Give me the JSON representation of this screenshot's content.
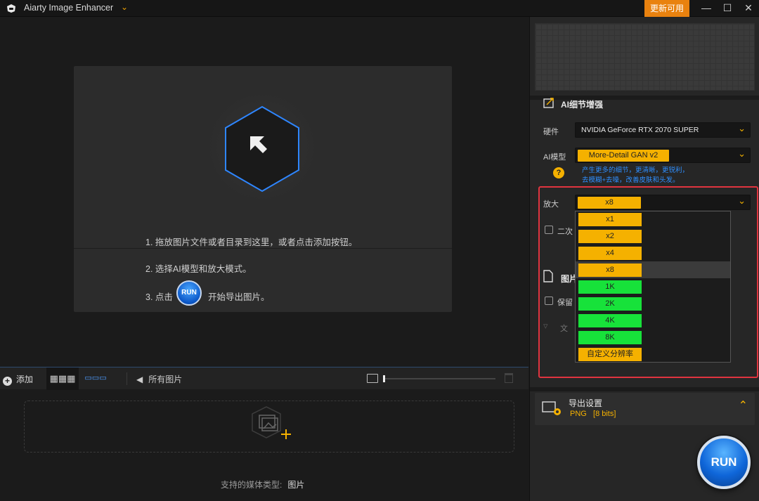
{
  "titlebar": {
    "app_title": "Aiarty Image Enhancer",
    "update_label": "更新可用",
    "minimize": "—",
    "maximize": "☐",
    "close": "✕"
  },
  "drop_area": {
    "step1": "1. 拖放图片文件或者目录到这里，或者点击添加按钮。",
    "step2": "2. 选择AI模型和放大模式。",
    "step3_prefix": "3. 点击",
    "step3_suffix": "开始导出图片。",
    "run_mini": "RUN"
  },
  "toolbar": {
    "add_label": "添加",
    "all_images": "所有图片"
  },
  "media": {
    "label": "支持的媒体类型:",
    "value": "图片"
  },
  "panel": {
    "section_title": "AI细节增强",
    "hardware_label": "硬件",
    "hardware_value": "NVIDIA GeForce RTX 2070 SUPER",
    "model_label": "AI模型",
    "model_value": "More-Detail GAN v2",
    "model_desc_1": "产生更多的细节，更清晰，更锐利，",
    "model_desc_2": "去模糊+去噪，改善皮肤和头发。",
    "scale_label": "放大",
    "scale_value": "x8",
    "second_label": "二次",
    "image_section": "图片",
    "keep_label": "保留",
    "text_label": "文"
  },
  "scale_options": [
    "x1",
    "x2",
    "x4",
    "x8",
    "1K",
    "2K",
    "4K",
    "8K",
    "自定义分辨率"
  ],
  "scale_selected": "x8",
  "export": {
    "title": "导出设置",
    "format": "PNG",
    "bits": "[8 bits]",
    "run_label": "RUN"
  },
  "colors": {
    "accent_orange": "#e9820f",
    "badge_yellow": "#f5b100",
    "option_green": "#17e23a",
    "highlight_red": "#e0343f",
    "run_blue": "#0f66d9"
  }
}
